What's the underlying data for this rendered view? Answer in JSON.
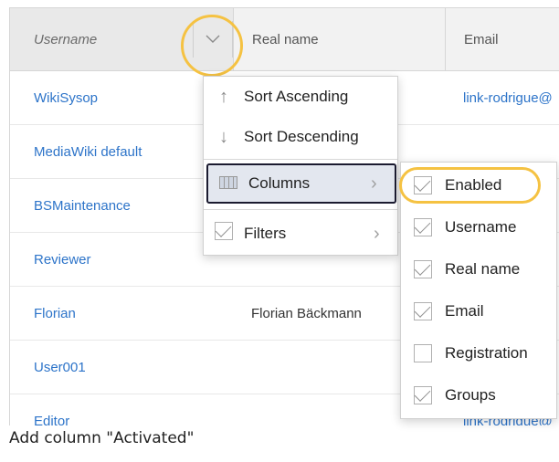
{
  "grid": {
    "columns": [
      "Username",
      "Real name",
      "Email"
    ],
    "rows": [
      {
        "username": "WikiSysop",
        "realname": "",
        "email": "link-rodrigue@"
      },
      {
        "username": "MediaWiki default",
        "realname": "",
        "email": ""
      },
      {
        "username": "BSMaintenance",
        "realname": "",
        "email": ""
      },
      {
        "username": "Reviewer",
        "realname": "",
        "email": ""
      },
      {
        "username": "Florian",
        "realname": "Florian Bäckmann",
        "email": ""
      },
      {
        "username": "User001",
        "realname": "",
        "email": ""
      },
      {
        "username": "Editor",
        "realname": "",
        "email": "link-rodrigue@"
      }
    ]
  },
  "column_menu": {
    "trigger_icon": "chevron-down-icon",
    "items": [
      {
        "label": "Sort Ascending",
        "icon": "arrow-up-icon"
      },
      {
        "label": "Sort Descending",
        "icon": "arrow-down-icon"
      },
      {
        "label": "Columns",
        "icon": "columns-icon",
        "submenu": true,
        "active": true
      },
      {
        "label": "Filters",
        "icon": "checkbox-icon",
        "submenu": true
      }
    ]
  },
  "columns_submenu": {
    "items": [
      {
        "label": "Enabled",
        "checked": true
      },
      {
        "label": "Username",
        "checked": true
      },
      {
        "label": "Real name",
        "checked": true
      },
      {
        "label": "Email",
        "checked": true
      },
      {
        "label": "Registration",
        "checked": false
      },
      {
        "label": "Groups",
        "checked": true
      }
    ]
  },
  "caption": "Add column \"Activated\"",
  "colors": {
    "link": "#2d74c9",
    "highlight_ring": "#f5c242",
    "active_border": "#1b1b30"
  }
}
